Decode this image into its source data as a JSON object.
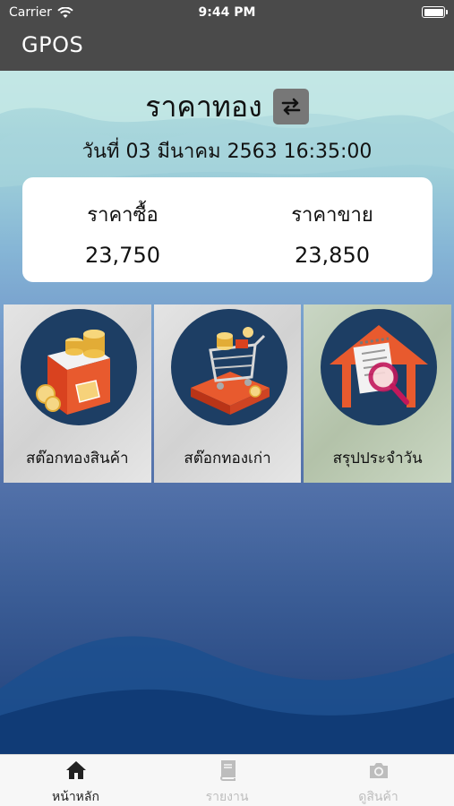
{
  "status_bar": {
    "carrier": "Carrier",
    "time": "9:44 PM"
  },
  "app": {
    "name": "GPOS"
  },
  "header": {
    "title": "ราคาทอง",
    "swap_icon": "swap-arrows-icon",
    "date": "วันที่ 03 มีนาคม 2563 16:35:00"
  },
  "prices": {
    "buy_label": "ราคาซื้อ",
    "buy_value": "23,750",
    "sell_label": "ราคาขาย",
    "sell_value": "23,850"
  },
  "tiles": [
    {
      "label": "สต๊อกทองสินค้า",
      "icon": "gold-box-icon"
    },
    {
      "label": "สต๊อกทองเก่า",
      "icon": "gold-cart-icon"
    },
    {
      "label": "สรุปประจำวัน",
      "icon": "house-report-icon"
    }
  ],
  "tabbar": {
    "items": [
      {
        "label": "หน้าหลัก",
        "icon": "home-icon",
        "active": true
      },
      {
        "label": "รายงาน",
        "icon": "book-icon",
        "active": false
      },
      {
        "label": "ดูสินค้า",
        "icon": "camera-icon",
        "active": false
      }
    ]
  },
  "colors": {
    "nav_bg": "#4a4a4a",
    "tile_circle": "#1d3e64",
    "gold": "#f0c14b",
    "red_box": "#d9421f"
  }
}
